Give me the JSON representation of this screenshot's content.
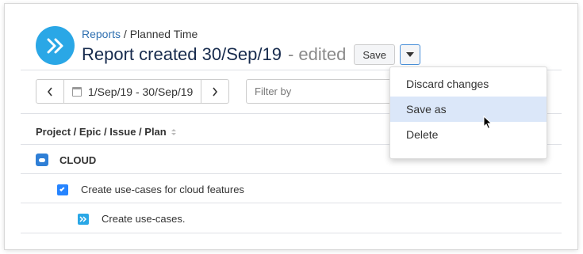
{
  "header": {
    "breadcrumb_link": "Reports",
    "breadcrumb_sep": "/",
    "breadcrumb_current": "Planned Time",
    "title": "Report created 30/Sep/19",
    "edited_text": "- edited",
    "save_label": "Save"
  },
  "toolbar": {
    "prev_icon": "chevron-left-icon",
    "date_range": "1/Sep/19 - 30/Sep/19",
    "next_icon": "chevron-right-icon",
    "filter_placeholder": "Filter by"
  },
  "table": {
    "column_header": "Project / Epic / Issue / Plan",
    "rows": [
      {
        "label": "CLOUD",
        "level": 0,
        "icon": "project-icon"
      },
      {
        "label": "Create use-cases for cloud features",
        "level": 1,
        "icon": "checkbox-icon"
      },
      {
        "label": "Create use-cases.",
        "level": 2,
        "icon": "subtask-icon"
      }
    ]
  },
  "dropdown": {
    "items": [
      {
        "label": "Discard changes",
        "active": false
      },
      {
        "label": "Save as",
        "active": true
      },
      {
        "label": "Delete",
        "active": false
      }
    ]
  },
  "colors": {
    "accent": "#2aa7e6",
    "link": "#2e6fb0",
    "hover": "#dbe7f9"
  }
}
